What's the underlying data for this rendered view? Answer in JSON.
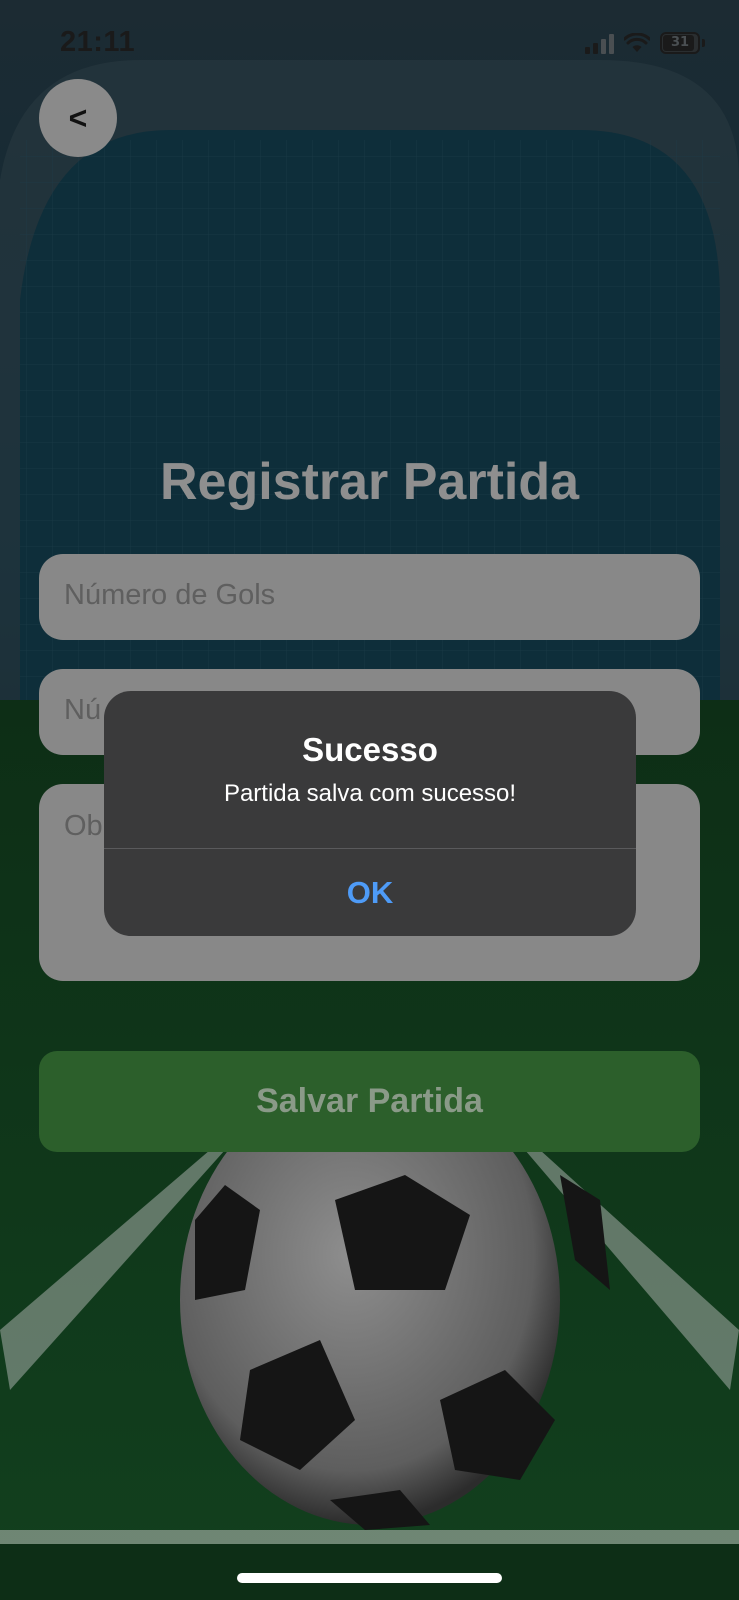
{
  "status_bar": {
    "time": "21:11",
    "battery": "31"
  },
  "header": {
    "back_label": "<"
  },
  "form": {
    "title": "Registrar Partida",
    "goals_placeholder": "Número de Gols",
    "number_placeholder": "Nú",
    "notes_placeholder": "Ob",
    "save_label": "Salvar Partida"
  },
  "alert": {
    "title": "Sucesso",
    "message": "Partida salva com sucesso!",
    "ok_label": "OK"
  },
  "colors": {
    "save_button": "#2c5f2b",
    "alert_bg": "#3a3a3b",
    "alert_action": "#4e9bf7"
  },
  "icons": [
    "cellular-signal-icon",
    "wifi-icon",
    "battery-icon",
    "back-chevron-icon",
    "soccer-ball-icon"
  ]
}
